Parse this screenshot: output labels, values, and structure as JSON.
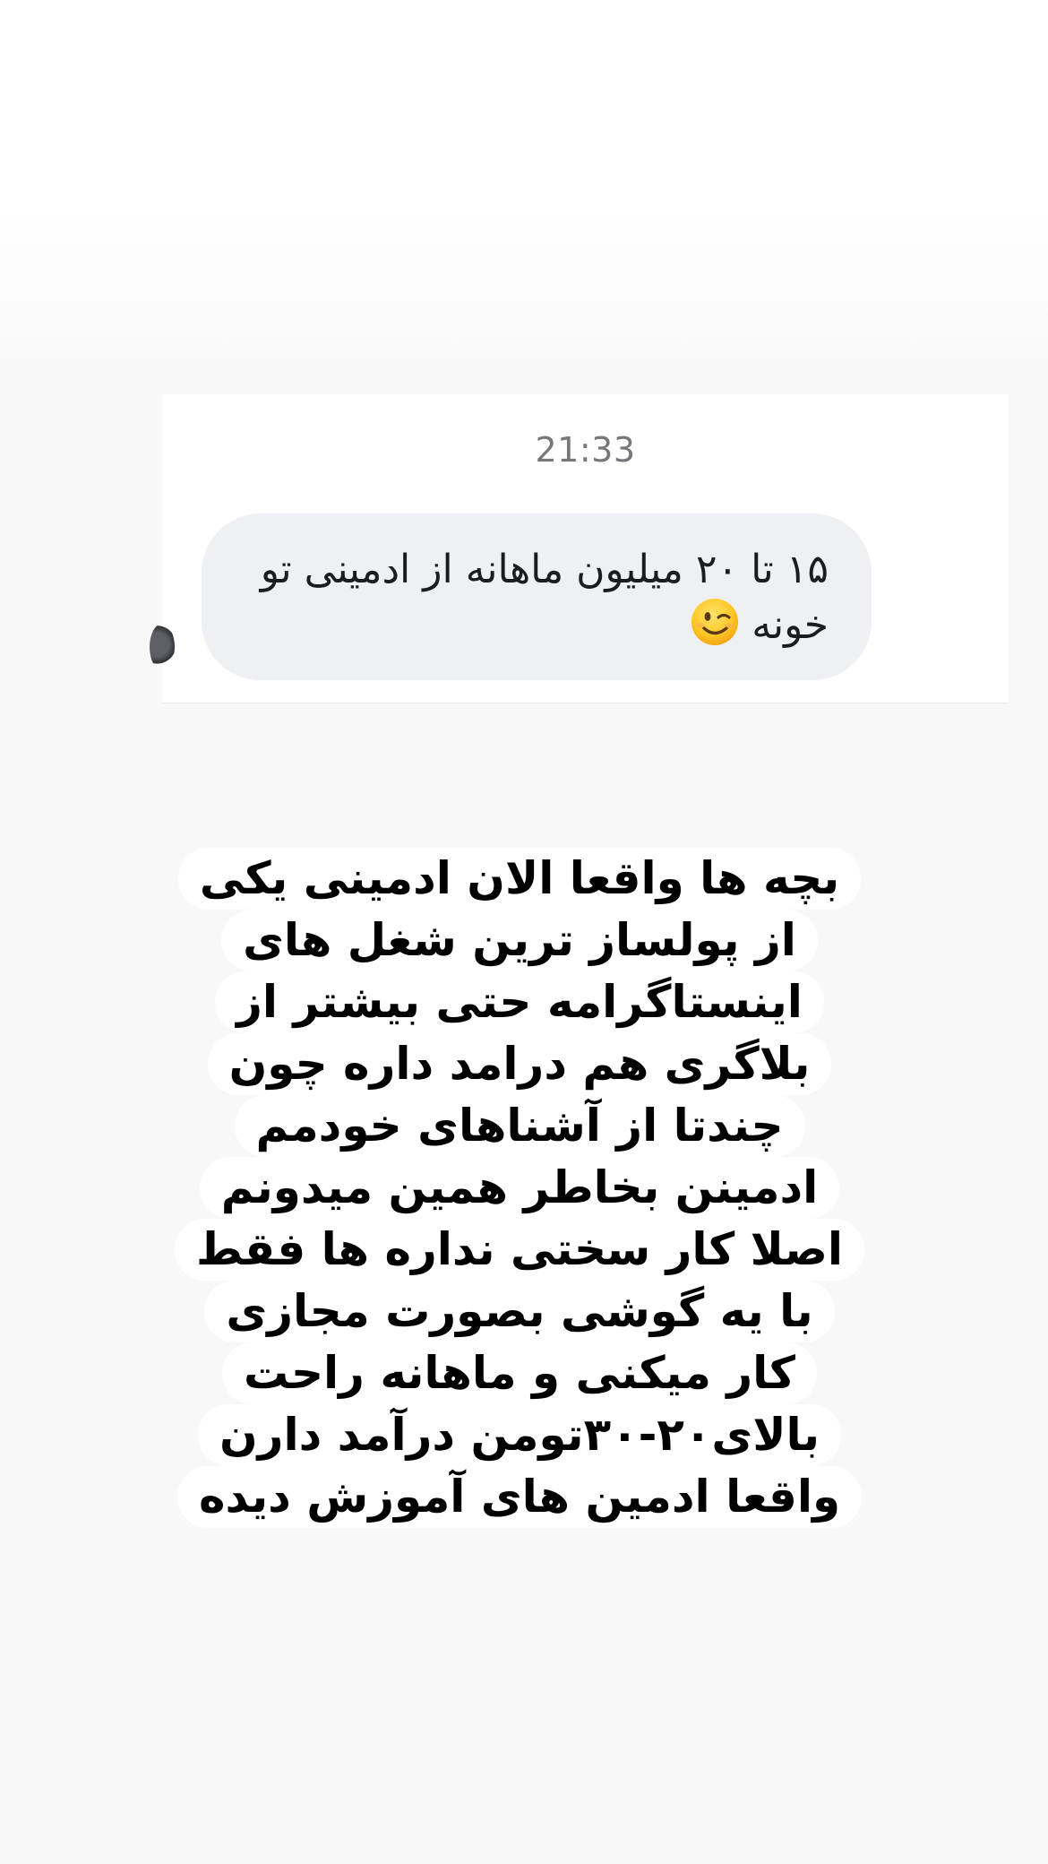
{
  "message": {
    "timestamp": "21:33",
    "text": "۱۵ تا ۲۰ میلیون ماهانه از ادمینی تو خونه",
    "emoji": "winking-face"
  },
  "caption": {
    "lines": [
      "بچه ها واقعا الان ادمینی یکی",
      "از پولساز ترین شغل های",
      "اینستاگرامه حتی بیشتر از",
      "بلاگری هم درامد داره چون",
      "چندتا از آشناهای خودمم",
      "ادمینن بخاطر همین میدونم",
      "اصلا کار سختی نداره ها فقط",
      "با یه گوشی بصورت مجازی",
      "کار میکنی و ماهانه راحت",
      "بالای۲۰-۳۰تومن درآمد دارن",
      "واقعا ادمین های آموزش دیده"
    ]
  },
  "colors": {
    "bubble": "#eef0f3",
    "timestamp": "#75777b",
    "caption_text": "#000000",
    "caption_highlight": "#ffffff"
  }
}
